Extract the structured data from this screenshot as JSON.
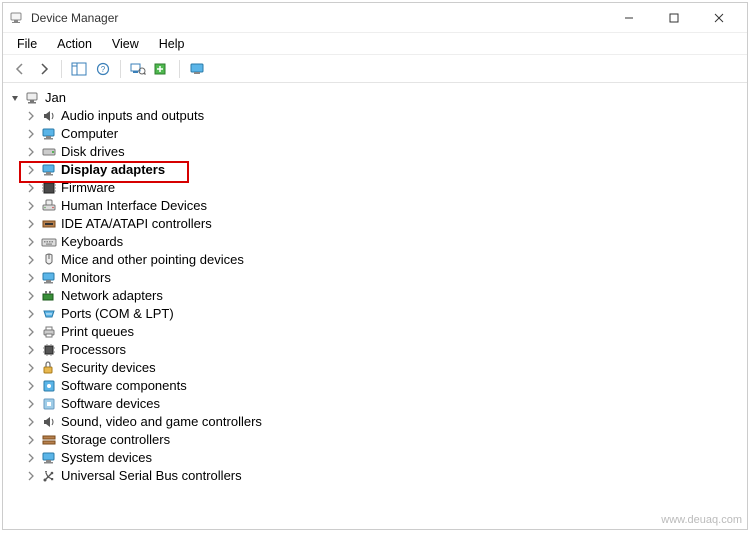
{
  "window": {
    "title": "Device Manager"
  },
  "menu": {
    "file": "File",
    "action": "Action",
    "view": "View",
    "help": "Help"
  },
  "tree": {
    "root": "Jan",
    "items": [
      "Audio inputs and outputs",
      "Computer",
      "Disk drives",
      "Display adapters",
      "Firmware",
      "Human Interface Devices",
      "IDE ATA/ATAPI controllers",
      "Keyboards",
      "Mice and other pointing devices",
      "Monitors",
      "Network adapters",
      "Ports (COM & LPT)",
      "Print queues",
      "Processors",
      "Security devices",
      "Software components",
      "Software devices",
      "Sound, video and game controllers",
      "Storage controllers",
      "System devices",
      "Universal Serial Bus controllers"
    ],
    "highlighted_index": 3
  },
  "watermark": "www.deuaq.com"
}
